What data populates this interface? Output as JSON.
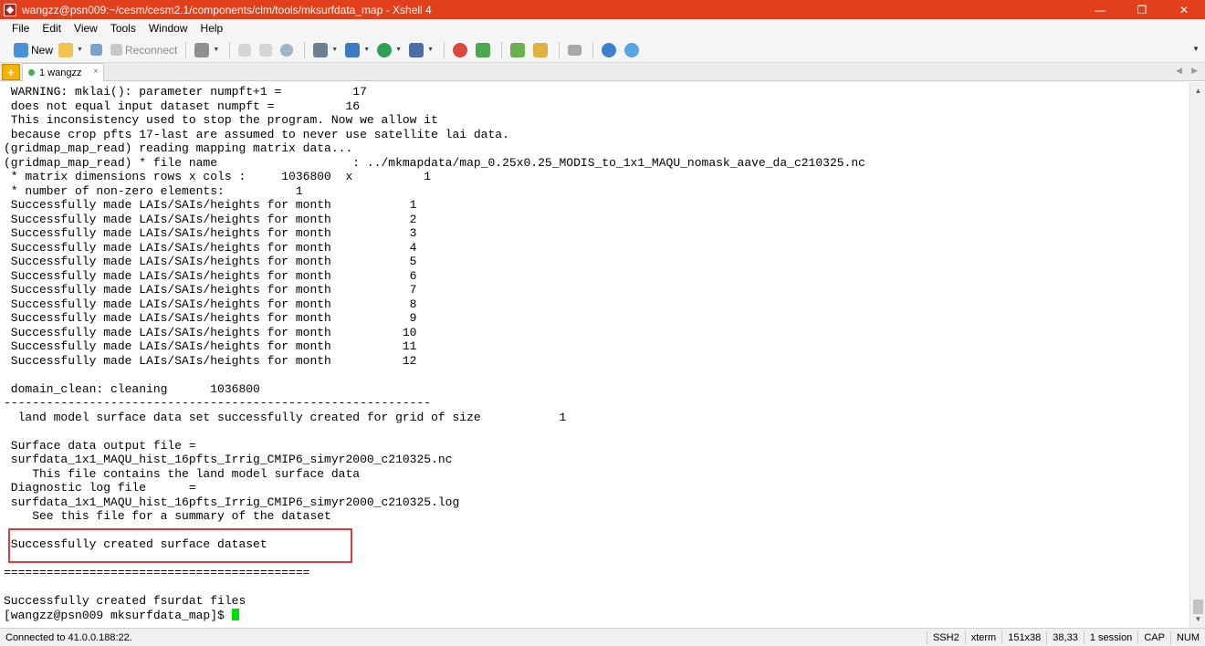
{
  "window": {
    "title": "wangzz@psn009:~/cesm/cesm2.1/components/clm/tools/mksurfdata_map - Xshell 4",
    "minimize": "—",
    "maximize": "❐",
    "close": "✕"
  },
  "menu": [
    "File",
    "Edit",
    "View",
    "Tools",
    "Window",
    "Help"
  ],
  "toolbar": {
    "new_label": "New",
    "reconnect_label": "Reconnect",
    "icons": [
      "new-session-icon",
      "open-folder-icon",
      "link-icon",
      "reconnect-icon",
      "properties-icon",
      "copy-icon",
      "paste-icon",
      "find-icon",
      "print-icon",
      "transfer-icon",
      "globe-icon",
      "script-icon",
      "stop-icon",
      "recycle-icon",
      "layout-icon",
      "lock-icon",
      "keyboard-icon",
      "help-icon",
      "chat-icon"
    ]
  },
  "tabs": {
    "add": "+",
    "session_label": "1 wangzz",
    "close": "×"
  },
  "terminal": {
    "lines": [
      " WARNING: mklai(): parameter numpft+1 =          17",
      " does not equal input dataset numpft =          16",
      " This inconsistency used to stop the program. Now we allow it",
      " because crop pfts 17-last are assumed to never use satellite lai data.",
      "(gridmap_map_read) reading mapping matrix data...",
      "(gridmap_map_read) * file name                   : ../mkmapdata/map_0.25x0.25_MODIS_to_1x1_MAQU_nomask_aave_da_c210325.nc",
      " * matrix dimensions rows x cols :     1036800  x          1",
      " * number of non-zero elements:          1",
      " Successfully made LAIs/SAIs/heights for month           1",
      " Successfully made LAIs/SAIs/heights for month           2",
      " Successfully made LAIs/SAIs/heights for month           3",
      " Successfully made LAIs/SAIs/heights for month           4",
      " Successfully made LAIs/SAIs/heights for month           5",
      " Successfully made LAIs/SAIs/heights for month           6",
      " Successfully made LAIs/SAIs/heights for month           7",
      " Successfully made LAIs/SAIs/heights for month           8",
      " Successfully made LAIs/SAIs/heights for month           9",
      " Successfully made LAIs/SAIs/heights for month          10",
      " Successfully made LAIs/SAIs/heights for month          11",
      " Successfully made LAIs/SAIs/heights for month          12",
      "",
      " domain_clean: cleaning      1036800",
      "------------------------------------------------------------",
      "  land model surface data set successfully created for grid of size           1",
      "",
      " Surface data output file =",
      " surfdata_1x1_MAQU_hist_16pfts_Irrig_CMIP6_simyr2000_c210325.nc",
      "    This file contains the land model surface data",
      " Diagnostic log file      =",
      " surfdata_1x1_MAQU_hist_16pfts_Irrig_CMIP6_simyr2000_c210325.log",
      "    See this file for a summary of the dataset",
      "",
      " Successfully created surface dataset",
      "",
      "===========================================",
      "",
      "Successfully created fsurdat files"
    ],
    "prompt": "[wangzz@psn009 mksurfdata_map]$ "
  },
  "status": {
    "connection": "Connected to 41.0.0.188:22.",
    "protocol": "SSH2",
    "term_type": "xterm",
    "size": "151x38",
    "cursor_pos": "38,33",
    "sessions": "1 session",
    "caps": "CAP",
    "num": "NUM"
  },
  "colors": {
    "titlebar": "#e2401c",
    "cursor": "#00e000",
    "highlight": "#e03b3b"
  }
}
